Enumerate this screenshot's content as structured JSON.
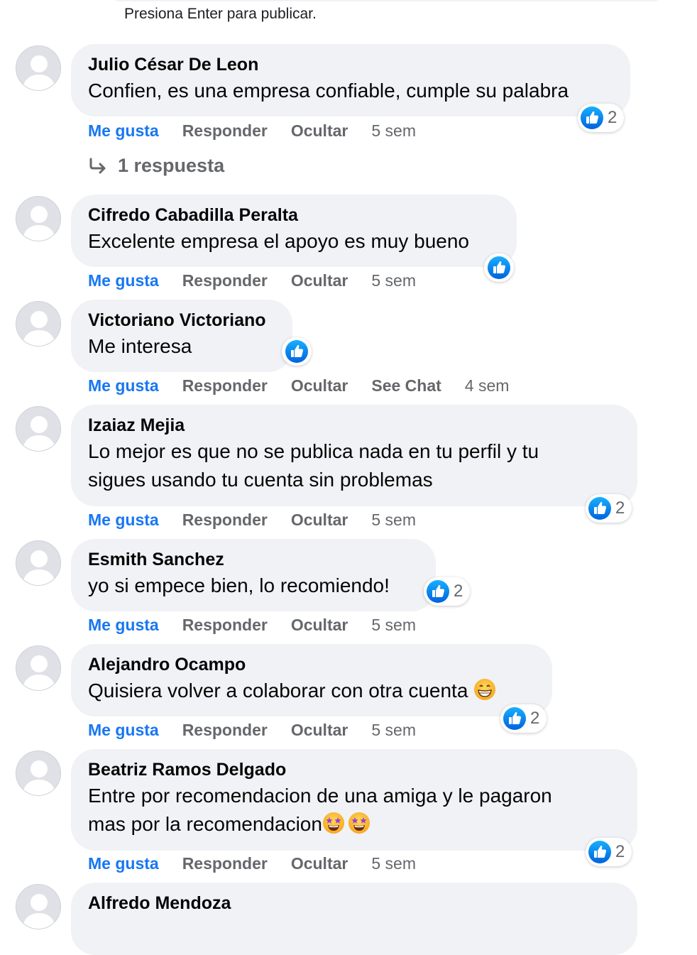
{
  "composer": {
    "hint": "Presiona Enter para publicar."
  },
  "colors": {
    "link_blue": "#1877f2",
    "meta_gray": "#65676b",
    "bubble_gray": "#f0f2f5"
  },
  "icons": {
    "reaction": "like-thumbs-up-icon",
    "reply": "reply-arrow-icon",
    "avatar": "default-avatar-icon",
    "grin": "grinning-face-emoji",
    "star_eyes": "star-struck-emoji"
  },
  "labels": {
    "like": "Me gusta",
    "reply": "Responder",
    "hide": "Ocultar",
    "see_chat": "See Chat"
  },
  "comments": [
    {
      "author": "Julio César De Leon",
      "lines": [
        "Confien, es una empresa confiable, cumple su palabra"
      ],
      "reactions": "2",
      "time": "5 sem",
      "replies": "1 respuesta"
    },
    {
      "author": "Cifredo Cabadilla Peralta",
      "lines": [
        "Excelente empresa el apoyo es muy bueno"
      ],
      "time": "5 sem"
    },
    {
      "author": "Victoriano Victoriano",
      "lines": [
        "Me interesa"
      ],
      "time": "4 sem"
    },
    {
      "author": "Izaiaz Mejia",
      "lines": [
        "Lo mejor es que no se publica nada en tu perfil y tu",
        "sigues usando tu cuenta sin problemas"
      ],
      "reactions": "2",
      "time": "5 sem"
    },
    {
      "author": "Esmith Sanchez",
      "lines": [
        "yo si empece bien, lo recomiendo!"
      ],
      "reactions": "2",
      "time": "5 sem"
    },
    {
      "author": "Alejandro Ocampo",
      "lines": [
        "Quisiera volver a colaborar con otra cuenta"
      ],
      "reactions": "2",
      "time": "5 sem"
    },
    {
      "author": "Beatriz Ramos Delgado",
      "lines": [
        "Entre por recomendacion de una amiga y le pagaron",
        "mas por la recomendacion"
      ],
      "reactions": "2",
      "time": "5 sem"
    },
    {
      "author": "Alfredo Mendoza",
      "lines": []
    }
  ]
}
